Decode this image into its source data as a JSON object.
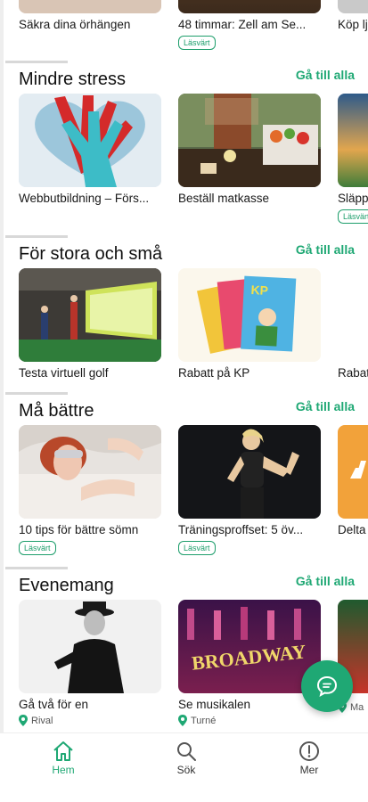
{
  "top_row": [
    {
      "title": "Säkra dina örhängen",
      "badge": ""
    },
    {
      "title": "48 timmar: Zell am Se...",
      "badge": "Läsvärt"
    },
    {
      "title": "Köp lj",
      "badge": ""
    }
  ],
  "sections": [
    {
      "title": "Mindre stress",
      "see_all": "Gå till alla",
      "cards": [
        {
          "title": "Webbutbildning – Förs...",
          "badge": "",
          "location": ""
        },
        {
          "title": "Beställ matkasse",
          "badge": "",
          "location": ""
        },
        {
          "title": "Släpp",
          "badge": "Läsvärt",
          "location": ""
        }
      ]
    },
    {
      "title": "För stora och små",
      "see_all": "Gå till alla",
      "cards": [
        {
          "title": "Testa virtuell golf",
          "badge": "",
          "location": ""
        },
        {
          "title": "Rabatt på KP",
          "badge": "",
          "location": ""
        },
        {
          "title": "Rabat",
          "badge": "",
          "location": ""
        }
      ]
    },
    {
      "title": "Må bättre",
      "see_all": "Gå till alla",
      "cards": [
        {
          "title": "10 tips för bättre sömn",
          "badge": "Läsvärt",
          "location": ""
        },
        {
          "title": "Träningsproffset: 5 öv...",
          "badge": "Läsvärt",
          "location": ""
        },
        {
          "title": "Delta",
          "badge": "",
          "location": ""
        }
      ]
    },
    {
      "title": "Evenemang",
      "see_all": "Gå till alla",
      "cards": [
        {
          "title": "Gå två för en",
          "badge": "",
          "location": "Rival"
        },
        {
          "title": "Se musikalen",
          "badge": "",
          "location": "Turné"
        },
        {
          "title": "",
          "badge": "",
          "location": "Ma"
        }
      ]
    }
  ],
  "broadway_text": "BROADWAY",
  "kp_text": "KP",
  "nav": [
    {
      "label": "Hem",
      "icon": "home-icon",
      "active": true
    },
    {
      "label": "Sök",
      "icon": "search-icon",
      "active": false
    },
    {
      "label": "Mer",
      "icon": "info-icon",
      "active": false
    }
  ],
  "colors": {
    "accent": "#1fa874",
    "text": "#1a1a1a"
  }
}
